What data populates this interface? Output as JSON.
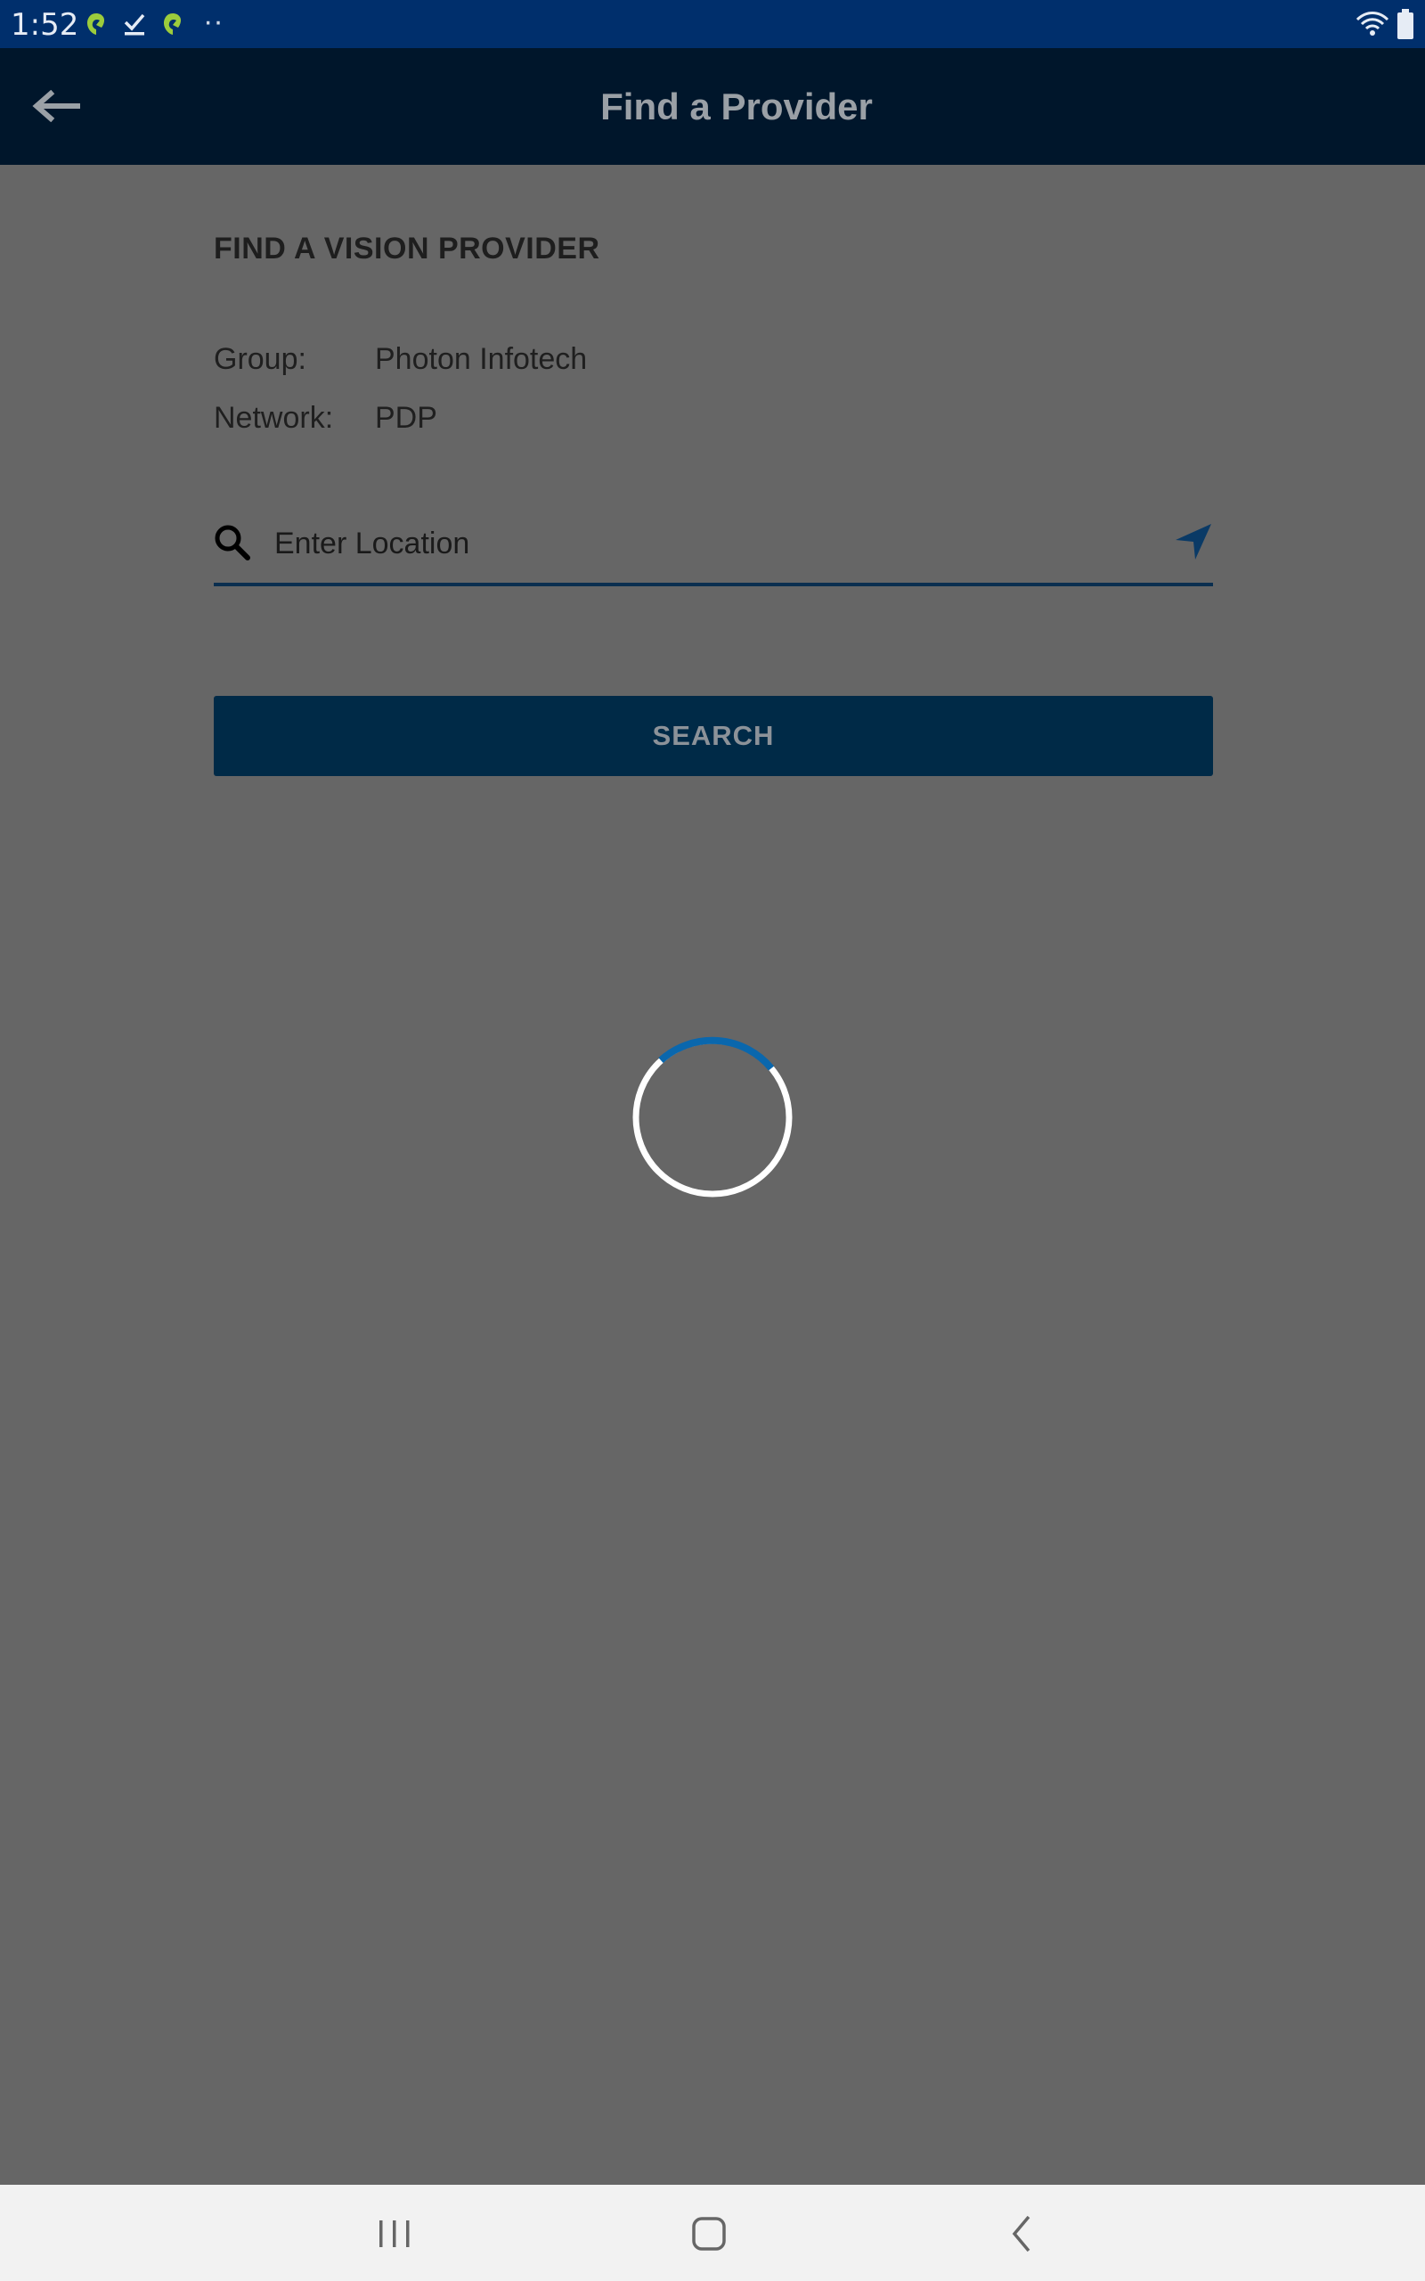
{
  "status_bar": {
    "time": "1:52",
    "dots": "··",
    "icons": [
      "app-notification-icon",
      "checkmark-notification-icon",
      "app-notification-icon",
      "wifi-icon",
      "battery-icon"
    ]
  },
  "app_bar": {
    "title": "Find a Provider",
    "back_icon": "arrow-left-icon"
  },
  "content": {
    "section_title": "FIND A VISION PROVIDER",
    "group_label": "Group:",
    "group_value": "Photon Infotech",
    "network_label": "Network:",
    "network_value": "PDP",
    "location_placeholder": "Enter Location",
    "location_value": "",
    "search_button": "SEARCH"
  },
  "loading": {
    "state": "loading",
    "colors": {
      "spinner_track": "#ffffff",
      "spinner_arc": "#0a67ad"
    }
  },
  "colors": {
    "status_bar": "#002f6c",
    "app_bar": "#00162b",
    "overlay": "#666666",
    "button": "#002a47",
    "nav_bar": "#f2f2f2"
  },
  "nav_bar": {
    "icons": [
      "recent-apps-icon",
      "home-icon",
      "back-icon"
    ]
  }
}
